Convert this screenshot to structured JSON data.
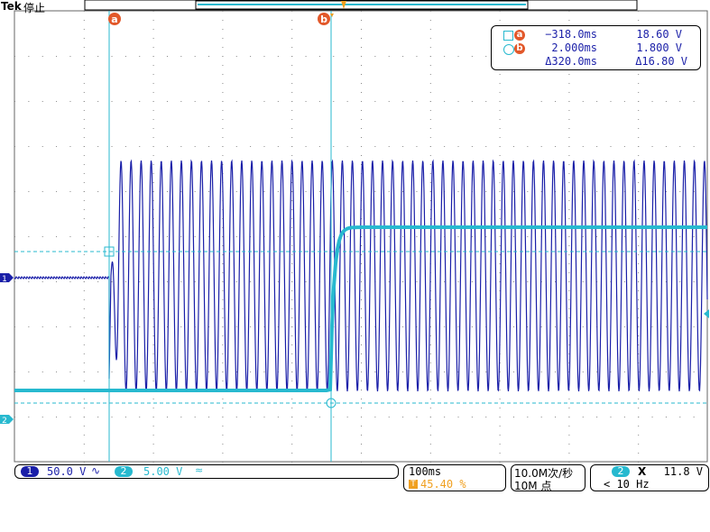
{
  "header": {
    "brand": "Tek",
    "run_state": "停止"
  },
  "cursor_markers": {
    "a": "a",
    "b": "b"
  },
  "cursor_readout": {
    "a_time": "−318.0ms",
    "a_volt": "18.60 V",
    "b_time": "2.000ms",
    "b_volt": "1.800 V",
    "delta_time": "Δ320.0ms",
    "delta_volt": "Δ16.80 V",
    "marker_a": "a",
    "marker_b": "b"
  },
  "channels": {
    "ch1": {
      "label": "1",
      "scale": "50.0 V",
      "coupling_symbol": "∿",
      "color": "#1a1fa8"
    },
    "ch2": {
      "label": "2",
      "scale": "5.00 V",
      "coupling_symbol": "≈",
      "color": "#27b9cf"
    }
  },
  "timebase": {
    "scale": "100ms",
    "trigger_pos_icon": "T",
    "trigger_pos": "45.40 %"
  },
  "acquisition": {
    "sample_rate": "10.0M次/秒",
    "record_length": "10M 点"
  },
  "measurement": {
    "channel": "2",
    "type": "X",
    "value": "11.8 V",
    "note": "< 10 Hz"
  },
  "colors": {
    "ch1": "#1a1fa8",
    "ch2": "#27b9cf",
    "cursor": "#27b9cf",
    "marker": "#e2582a",
    "trigger": "#f0a020"
  }
}
